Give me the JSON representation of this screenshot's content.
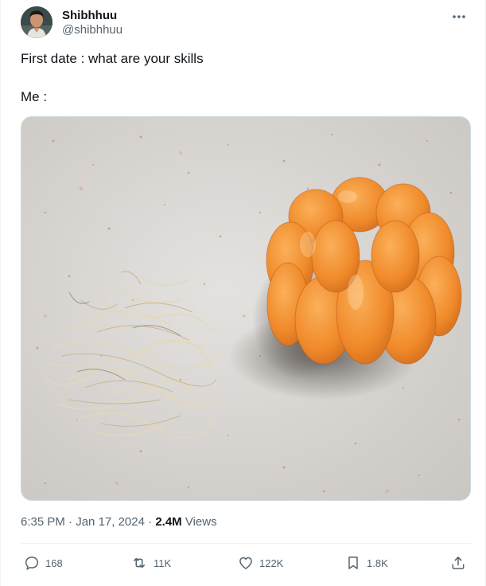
{
  "author": {
    "name": "Shibhhuu",
    "handle": "@shibhhuu"
  },
  "tweet": {
    "line1": "First date : what are your skills",
    "line2": "Me :"
  },
  "meta": {
    "time": "6:35 PM",
    "separator1": "·",
    "date": "Jan 17, 2024",
    "separator2": "·",
    "views_count": "2.4M",
    "views_label": "Views"
  },
  "actions": {
    "replies": "168",
    "retweets": "11K",
    "likes": "122K",
    "bookmarks": "1.8K"
  },
  "colors": {
    "text": "#0f1419",
    "secondary": "#536471",
    "border": "#cfd9de",
    "orange": "#f08a2a"
  },
  "icons": [
    "more-icon",
    "reply-icon",
    "retweet-icon",
    "like-icon",
    "bookmark-icon",
    "share-icon"
  ]
}
